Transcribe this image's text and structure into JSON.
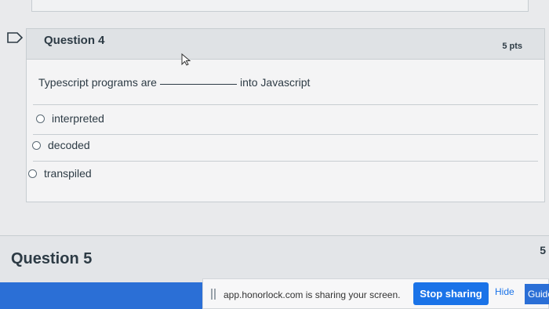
{
  "question4": {
    "title": "Question 4",
    "points": "5 pts",
    "prompt_before": "Typescript programs are",
    "prompt_after": "into Javascript",
    "answers": [
      {
        "label": "interpreted",
        "selected": false
      },
      {
        "label": "decoded",
        "selected": false
      },
      {
        "label": "transpiled",
        "selected": false
      }
    ]
  },
  "question5": {
    "title": "Question 5",
    "points": "5"
  },
  "share_bar": {
    "message": "app.honorlock.com is sharing your screen.",
    "stop_label": "Stop sharing",
    "hide_label": "Hide",
    "guide_label": "Guide"
  },
  "colors": {
    "accent": "#1a73e8",
    "header_bg": "#dfe2e5",
    "text": "#2d3b45"
  }
}
